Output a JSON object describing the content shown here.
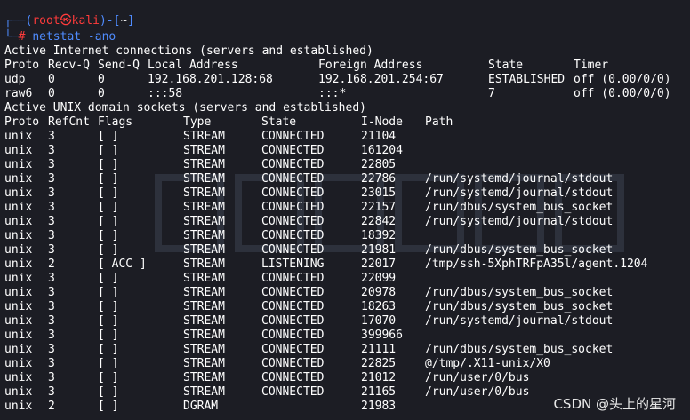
{
  "prompt": {
    "corner_top": "┌──(",
    "user": "root",
    "at": "㉿",
    "host": "kali",
    "close_paren": ")-[",
    "path": "~",
    "close_bracket": "]",
    "corner_bottom": "└─",
    "hash": "#",
    "command": "netstat -ano"
  },
  "inet": {
    "heading": "Active Internet connections (servers and established)",
    "headers": [
      "Proto",
      "Recv-Q",
      "Send-Q",
      "Local Address",
      "Foreign Address",
      "State",
      "Timer"
    ],
    "rows": [
      [
        "udp",
        "0",
        "0",
        "192.168.201.128:68",
        "192.168.201.254:67",
        "ESTABLISHED",
        "off (0.00/0/0)"
      ],
      [
        "raw6",
        "0",
        "0",
        ":::58",
        ":::*",
        "7",
        "off (0.00/0/0)"
      ]
    ]
  },
  "unix": {
    "heading": "Active UNIX domain sockets (servers and established)",
    "headers": [
      "Proto",
      "RefCnt",
      "Flags",
      "Type",
      "State",
      "I-Node",
      "Path"
    ],
    "rows": [
      [
        "unix",
        "3",
        "[ ]",
        "STREAM",
        "CONNECTED",
        "21104",
        ""
      ],
      [
        "unix",
        "3",
        "[ ]",
        "STREAM",
        "CONNECTED",
        "161204",
        ""
      ],
      [
        "unix",
        "3",
        "[ ]",
        "STREAM",
        "CONNECTED",
        "22805",
        ""
      ],
      [
        "unix",
        "3",
        "[ ]",
        "STREAM",
        "CONNECTED",
        "22786",
        "/run/systemd/journal/stdout"
      ],
      [
        "unix",
        "3",
        "[ ]",
        "STREAM",
        "CONNECTED",
        "23015",
        "/run/systemd/journal/stdout"
      ],
      [
        "unix",
        "3",
        "[ ]",
        "STREAM",
        "CONNECTED",
        "22157",
        "/run/dbus/system_bus_socket"
      ],
      [
        "unix",
        "3",
        "[ ]",
        "STREAM",
        "CONNECTED",
        "22842",
        "/run/systemd/journal/stdout"
      ],
      [
        "unix",
        "3",
        "[ ]",
        "STREAM",
        "CONNECTED",
        "18392",
        ""
      ],
      [
        "unix",
        "3",
        "[ ]",
        "STREAM",
        "CONNECTED",
        "21981",
        "/run/dbus/system_bus_socket"
      ],
      [
        "unix",
        "2",
        "[ ACC ]",
        "STREAM",
        "LISTENING",
        "22017",
        "/tmp/ssh-5XphTRFpA35l/agent.1204"
      ],
      [
        "unix",
        "3",
        "[ ]",
        "STREAM",
        "CONNECTED",
        "22099",
        ""
      ],
      [
        "unix",
        "3",
        "[ ]",
        "STREAM",
        "CONNECTED",
        "20978",
        "/run/dbus/system_bus_socket"
      ],
      [
        "unix",
        "3",
        "[ ]",
        "STREAM",
        "CONNECTED",
        "18263",
        "/run/dbus/system_bus_socket"
      ],
      [
        "unix",
        "3",
        "[ ]",
        "STREAM",
        "CONNECTED",
        "17070",
        "/run/systemd/journal/stdout"
      ],
      [
        "unix",
        "3",
        "[ ]",
        "STREAM",
        "CONNECTED",
        "399966",
        ""
      ],
      [
        "unix",
        "3",
        "[ ]",
        "STREAM",
        "CONNECTED",
        "21111",
        "/run/dbus/system_bus_socket"
      ],
      [
        "unix",
        "3",
        "[ ]",
        "STREAM",
        "CONNECTED",
        "22825",
        "@/tmp/.X11-unix/X0"
      ],
      [
        "unix",
        "3",
        "[ ]",
        "STREAM",
        "CONNECTED",
        "21012",
        "/run/user/0/bus"
      ],
      [
        "unix",
        "3",
        "[ ]",
        "STREAM",
        "CONNECTED",
        "21165",
        "/run/user/0/bus"
      ],
      [
        "unix",
        "2",
        "[ ]",
        "DGRAM",
        "",
        "21983",
        ""
      ]
    ]
  },
  "watermark_label": "CSDN @头上的星河",
  "colors": {
    "background": "#1c1d24",
    "text": "#ffffff",
    "prompt_blue": "#4f8cff",
    "prompt_red": "#ff3b3b"
  }
}
